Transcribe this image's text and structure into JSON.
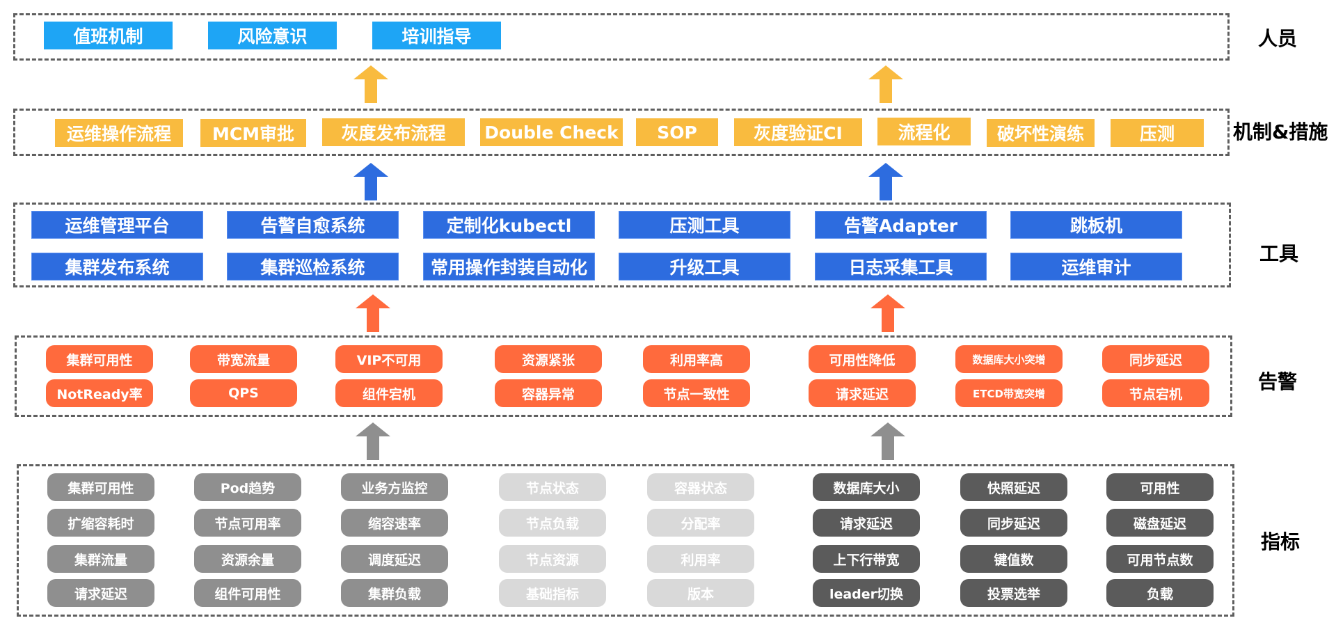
{
  "colors": {
    "people": "#1ea5f5",
    "mechanism": "#f9bb3f",
    "tools": "#2d6cdf",
    "alarms": "#ff6a3d",
    "metrics_mid": "#8f8f8f",
    "metrics_light": "#d9d9d9",
    "metrics_dark": "#5b5b5b",
    "arrow_people": "#f9bb3f",
    "arrow_mechanism": "#2d6cdf",
    "arrow_tools": "#ff6a3d",
    "arrow_alarms": "#8f8f8f"
  },
  "layers": {
    "people": {
      "label": "人员",
      "items": [
        "值班机制",
        "风险意识",
        "培训指导"
      ]
    },
    "mechanism": {
      "label": "机制&措施",
      "items": [
        "运维操作流程",
        "MCM审批",
        "灰度发布流程",
        "Double Check",
        "SOP",
        "灰度验证CI",
        "流程化",
        "破坏性演练",
        "压测"
      ]
    },
    "tools": {
      "label": "工具",
      "row1": [
        "运维管理平台",
        "告警自愈系统",
        "定制化kubectl",
        "压测工具",
        "告警Adapter",
        "跳板机"
      ],
      "row2": [
        "集群发布系统",
        "集群巡检系统",
        "常用操作封装自动化",
        "升级工具",
        "日志采集工具",
        "运维审计"
      ]
    },
    "alarms": {
      "label": "告警",
      "row1": [
        "集群可用性",
        "带宽流量",
        "VIP不可用",
        "资源紧张",
        "利用率高",
        "可用性降低",
        "数据库大小突增",
        "同步延迟"
      ],
      "row2": [
        "NotReady率",
        "QPS",
        "组件宕机",
        "容器异常",
        "节点一致性",
        "请求延迟",
        "ETCD带宽突增",
        "节点宕机"
      ]
    },
    "metrics": {
      "label": "指标",
      "columns": [
        {
          "tone": "mid",
          "items": [
            "集群可用性",
            "扩缩容耗时",
            "集群流量",
            "请求延迟"
          ]
        },
        {
          "tone": "mid",
          "items": [
            "Pod趋势",
            "节点可用率",
            "资源余量",
            "组件可用性"
          ]
        },
        {
          "tone": "mid",
          "items": [
            "业务方监控",
            "缩容速率",
            "调度延迟",
            "集群负载"
          ]
        },
        {
          "tone": "light",
          "items": [
            "节点状态",
            "节点负载",
            "节点资源",
            "基础指标"
          ]
        },
        {
          "tone": "light",
          "items": [
            "容器状态",
            "分配率",
            "利用率",
            "版本"
          ]
        },
        {
          "tone": "dark",
          "items": [
            "数据库大小",
            "请求延迟",
            "上下行带宽",
            "leader切换"
          ]
        },
        {
          "tone": "dark",
          "items": [
            "快照延迟",
            "同步延迟",
            "键值数",
            "投票选举"
          ]
        },
        {
          "tone": "dark",
          "items": [
            "可用性",
            "磁盘延迟",
            "可用节点数",
            "负载"
          ]
        }
      ]
    }
  }
}
